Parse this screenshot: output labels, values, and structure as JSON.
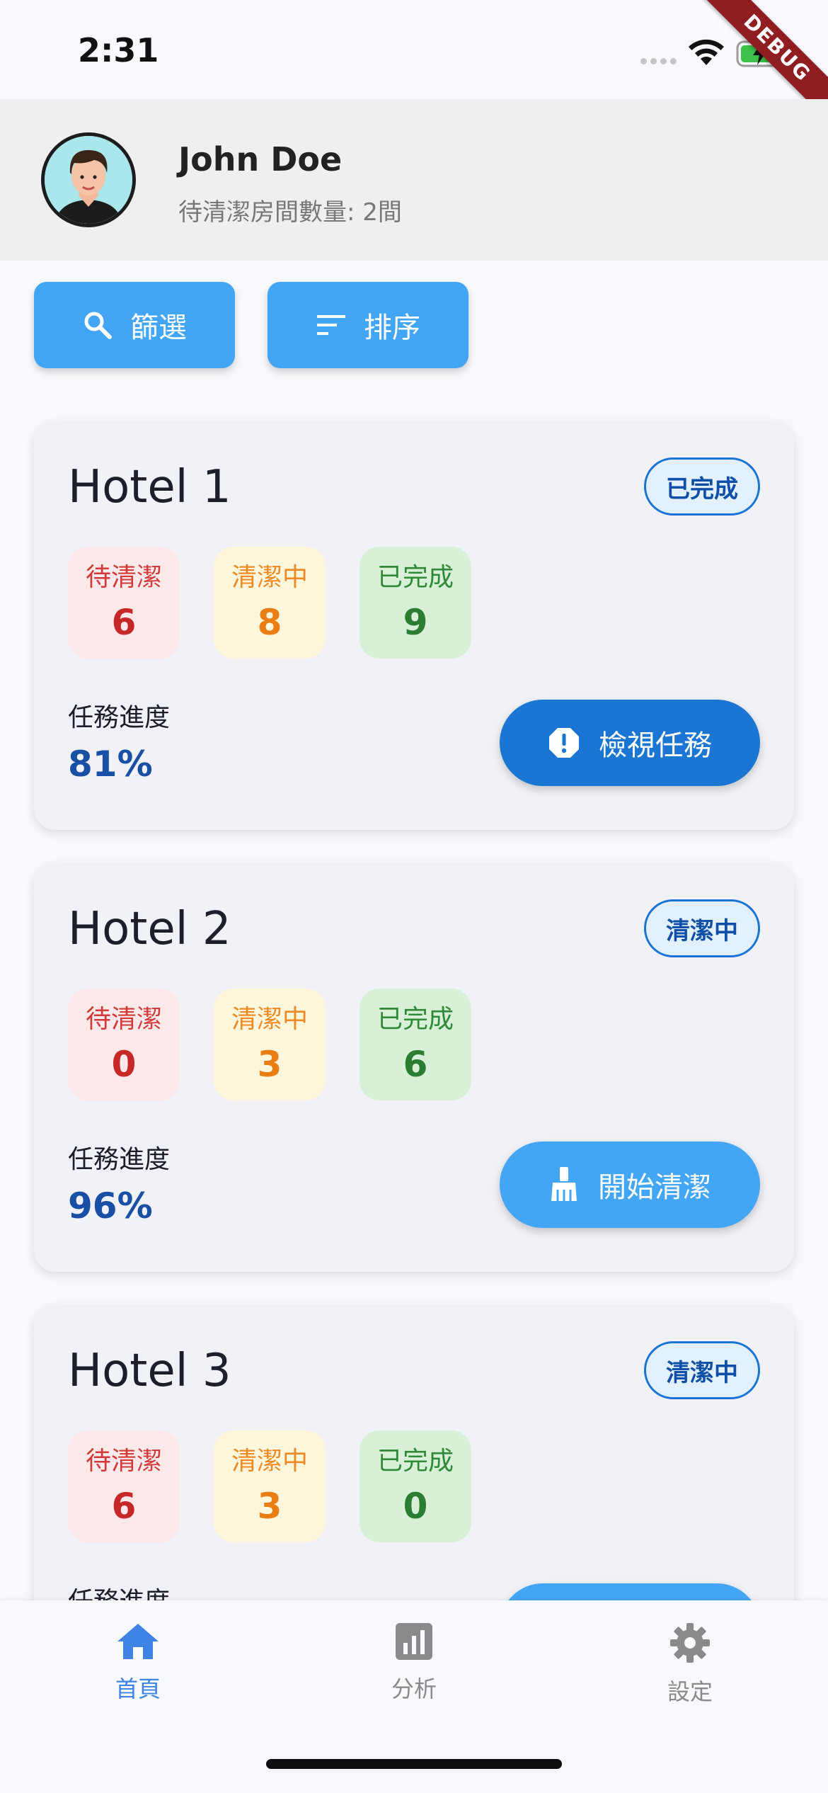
{
  "status_bar": {
    "time": "2:31",
    "debug_label": "DEBUG"
  },
  "profile": {
    "name": "John Doe",
    "subtitle": "待清潔房間數量: 2間"
  },
  "actions": {
    "filter_label": "篩選",
    "sort_label": "排序"
  },
  "labels": {
    "pending": "待清潔",
    "cleaning": "清潔中",
    "done": "已完成",
    "progress": "任務進度"
  },
  "hotels": [
    {
      "name": "Hotel 1",
      "status": "已完成",
      "pending": "6",
      "cleaning": "8",
      "done": "9",
      "progress": "81%",
      "button_label": "檢視任務",
      "button_icon": "alert-icon"
    },
    {
      "name": "Hotel 2",
      "status": "清潔中",
      "pending": "0",
      "cleaning": "3",
      "done": "6",
      "progress": "96%",
      "button_label": "開始清潔",
      "button_icon": "broom-icon"
    },
    {
      "name": "Hotel 3",
      "status": "清潔中",
      "pending": "6",
      "cleaning": "3",
      "done": "0",
      "progress": "",
      "button_label": "",
      "button_icon": ""
    }
  ],
  "nav": [
    {
      "label": "首頁",
      "icon": "home-icon",
      "active": true
    },
    {
      "label": "分析",
      "icon": "analytics-icon",
      "active": false
    },
    {
      "label": "設定",
      "icon": "settings-icon",
      "active": false
    }
  ],
  "colors": {
    "primary_button": "#43a5f5",
    "dark_button": "#1a76d2",
    "active_nav": "#3f84e5",
    "pending_bg": "#fde8ea",
    "cleaning_bg": "#fff6dc",
    "done_bg": "#d9f0d8"
  }
}
